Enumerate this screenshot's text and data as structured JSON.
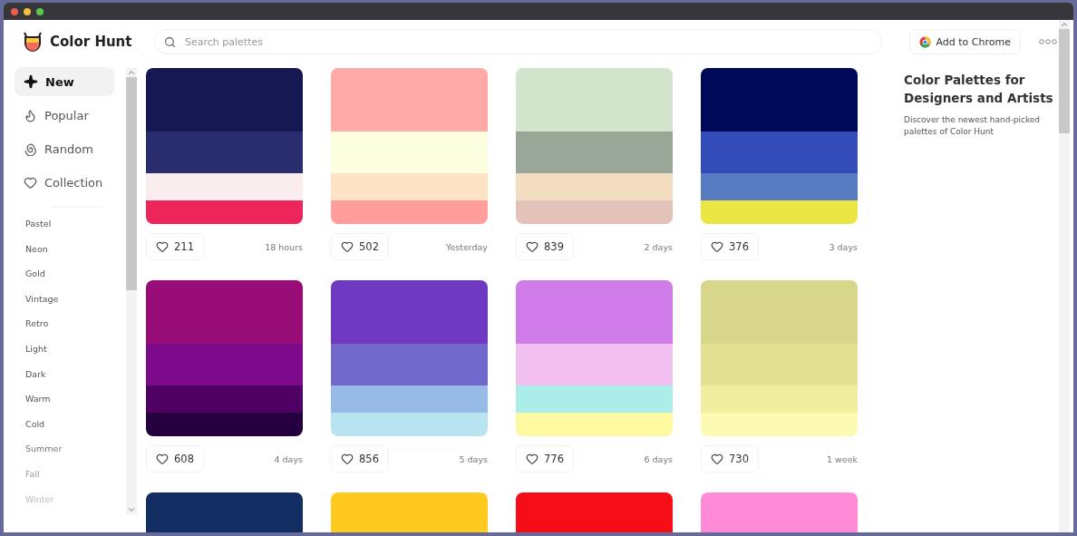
{
  "brand": {
    "name": "Color Hunt"
  },
  "search": {
    "placeholder": "Search palettes"
  },
  "header_actions": {
    "chrome_button": "Add to Chrome"
  },
  "nav": [
    {
      "label": "New",
      "selected": true
    },
    {
      "label": "Popular",
      "selected": false
    },
    {
      "label": "Random",
      "selected": false
    },
    {
      "label": "Collection",
      "selected": false
    }
  ],
  "categories": [
    "Pastel",
    "Neon",
    "Gold",
    "Vintage",
    "Retro",
    "Light",
    "Dark",
    "Warm",
    "Cold",
    "Summer",
    "Fall",
    "Winter"
  ],
  "palettes": [
    {
      "swatches": [
        {
          "color": "#161853"
        },
        {
          "color": "#292c6d"
        },
        {
          "color": "#faedf0"
        },
        {
          "color": "#ec255a"
        }
      ],
      "likes": "211",
      "time": "18 hours"
    },
    {
      "swatches": [
        {
          "color": "#ffaaa7"
        },
        {
          "color": "#fbffdf"
        },
        {
          "color": "#fde3c4"
        },
        {
          "color": "#ff9e9a"
        }
      ],
      "likes": "502",
      "time": "Yesterday"
    },
    {
      "swatches": [
        {
          "color": "#d3e4cd"
        },
        {
          "color": "#99a799"
        },
        {
          "color": "#f2ddc1"
        },
        {
          "color": "#e2c2b9"
        }
      ],
      "likes": "839",
      "time": "2 days"
    },
    {
      "swatches": [
        {
          "color": "#000957"
        },
        {
          "color": "#344cb7"
        },
        {
          "color": "#577bc1"
        },
        {
          "color": "#ebe645"
        }
      ],
      "likes": "376",
      "time": "3 days"
    },
    {
      "swatches": [
        {
          "color": "#990d78"
        },
        {
          "color": "#7c0a8a"
        },
        {
          "color": "#4e0063"
        },
        {
          "color": "#25003e"
        }
      ],
      "likes": "608",
      "time": "4 days"
    },
    {
      "swatches": [
        {
          "color": "#6f3ac1"
        },
        {
          "color": "#7267cb"
        },
        {
          "color": "#98bae7"
        },
        {
          "color": "#b8e4f0"
        }
      ],
      "likes": "856",
      "time": "5 days"
    },
    {
      "swatches": [
        {
          "color": "#d07ce8"
        },
        {
          "color": "#f2c0f0"
        },
        {
          "color": "#abede8"
        },
        {
          "color": "#fcf9a0"
        }
      ],
      "likes": "776",
      "time": "6 days"
    },
    {
      "swatches": [
        {
          "color": "#d8d68b"
        },
        {
          "color": "#e5e193"
        },
        {
          "color": "#f1ee9f"
        },
        {
          "color": "#fdfab4"
        }
      ],
      "likes": "730",
      "time": "1 week"
    },
    {
      "swatches": [
        {
          "color": "#132e63"
        }
      ]
    },
    {
      "swatches": [
        {
          "color": "#ffc91e"
        }
      ]
    },
    {
      "swatches": [
        {
          "color": "#f50d17"
        }
      ]
    },
    {
      "swatches": [
        {
          "color": "#ff8ad8"
        }
      ]
    }
  ],
  "aside": {
    "title": "Color Palettes for Designers and Artists",
    "description": "Discover the newest hand-picked palettes of Color Hunt"
  }
}
